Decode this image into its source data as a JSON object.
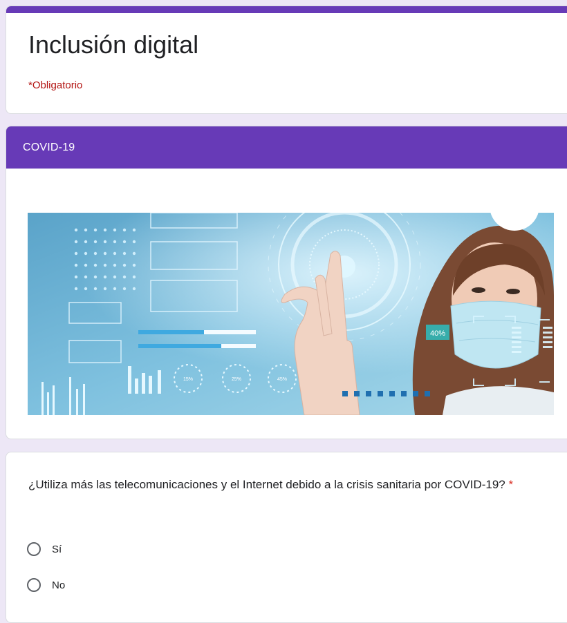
{
  "form": {
    "title": "Inclusión digital",
    "required_note": "*Obligatorio",
    "accent_color": "#673ab7",
    "required_color": "#d93025"
  },
  "section": {
    "title": "COVID-19",
    "image": {
      "labels": [
        "40%",
        "15%",
        "25%",
        "45%"
      ]
    }
  },
  "question": {
    "text": "¿Utiliza más las telecomunicaciones y el Internet debido a la crisis sanitaria por COVID-19?",
    "required_mark": "*",
    "options": [
      {
        "label": "Sí"
      },
      {
        "label": "No"
      }
    ]
  }
}
